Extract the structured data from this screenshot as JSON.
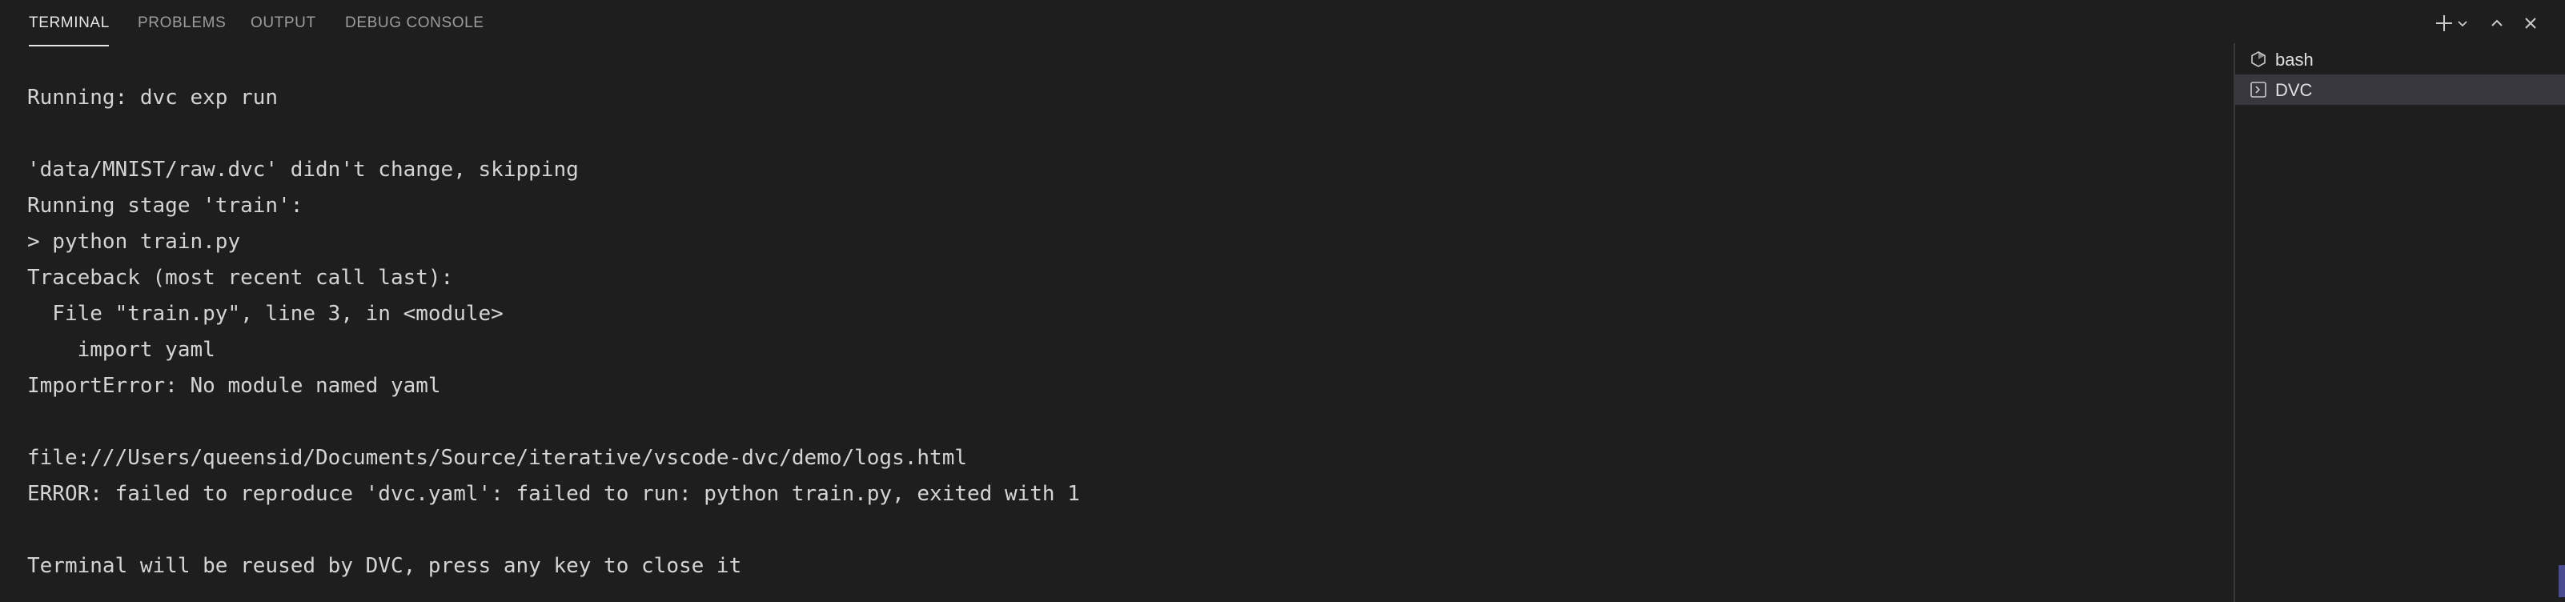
{
  "tabs": {
    "terminal": "TERMINAL",
    "problems": "PROBLEMS",
    "output": "OUTPUT",
    "debug_console": "DEBUG CONSOLE",
    "active": "TERMINAL"
  },
  "actions": {
    "new_terminal_icon": "plus-icon",
    "launch_profile_icon": "chevron-down-icon",
    "maximize_icon": "chevron-up-icon",
    "close_icon": "close-icon"
  },
  "terminal": {
    "lines": [
      "Running: dvc exp run",
      "",
      "'data/MNIST/raw.dvc' didn't change, skipping",
      "Running stage 'train':",
      "> python train.py",
      "Traceback (most recent call last):",
      "  File \"train.py\", line 3, in <module>",
      "    import yaml",
      "ImportError: No module named yaml",
      "",
      "file:///Users/queensid/Documents/Source/iterative/vscode-dvc/demo/logs.html",
      "ERROR: failed to reproduce 'dvc.yaml': failed to run: python train.py, exited with 1",
      "",
      "Terminal will be reused by DVC, press any key to close it"
    ]
  },
  "terminal_list": {
    "items": [
      {
        "label": "bash",
        "icon": "terminal-bash-icon",
        "selected": false
      },
      {
        "label": "DVC",
        "icon": "terminal-prompt-icon",
        "selected": true
      }
    ]
  },
  "colors": {
    "background": "#1e1e1e",
    "text": "#d4d4d4",
    "tab_inactive": "#9d9d9d",
    "tab_active": "#e7e7e7",
    "selected_item": "#37373d"
  }
}
